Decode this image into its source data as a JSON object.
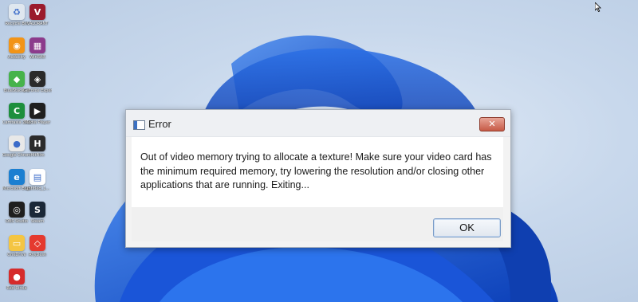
{
  "desktop": {
    "icons": [
      {
        "name": "recycle-bin-icon",
        "label": "Recycle Bin",
        "color": "#dfe7ef",
        "glyph": "♻"
      },
      {
        "name": "valorant-icon",
        "label": "VALORANT",
        "color": "#9b1b2c",
        "glyph": "V"
      },
      {
        "name": "audacity-icon",
        "label": "Audacity",
        "color": "#f29417",
        "glyph": "◉"
      },
      {
        "name": "winrar-icon",
        "label": "WinRAR",
        "color": "#8c3b8c",
        "glyph": "▦"
      },
      {
        "name": "bluestacks-icon",
        "label": "BlueStacks 5",
        "color": "#46b34b",
        "glyph": "◆"
      },
      {
        "name": "geforce-experience-icon",
        "label": "GeForce Experience",
        "color": "#2a2a2a",
        "glyph": "◈"
      },
      {
        "name": "camtasia-icon",
        "label": "Camtasia 2021",
        "color": "#1d8f3d",
        "glyph": "C"
      },
      {
        "name": "media-player-icon",
        "label": "Media Player",
        "color": "#1f1f1f",
        "glyph": "▶"
      },
      {
        "name": "google-chrome-icon",
        "label": "Google Chrome",
        "color": "#e8e8e8",
        "glyph": "●"
      },
      {
        "name": "hitfilm-icon",
        "label": "HitFilm",
        "color": "#2b2b2b",
        "glyph": "H"
      },
      {
        "name": "microsoft-edge-icon",
        "label": "Microsoft Edge",
        "color": "#1b7fd1",
        "glyph": "e"
      },
      {
        "name": "document-file-icon",
        "label": "Untitled_1...",
        "color": "#ffffff",
        "glyph": "▤"
      },
      {
        "name": "obs-studio-icon",
        "label": "OBS Studio",
        "color": "#1f1f1f",
        "glyph": "◎"
      },
      {
        "name": "steam-icon",
        "label": "Steam",
        "color": "#1b2838",
        "glyph": "S"
      },
      {
        "name": "onedrive-icon",
        "label": "OneDrive",
        "color": "#f4c542",
        "glyph": "▭"
      },
      {
        "name": "anydesk-icon",
        "label": "AnyDesk",
        "color": "#e53a2f",
        "glyph": "◇"
      },
      {
        "name": "red-circle-app-icon",
        "label": "Red Circle",
        "color": "#d62b2b",
        "glyph": "●"
      }
    ]
  },
  "dialog": {
    "title": "Error",
    "close_glyph": "✕",
    "message": "Out of video memory trying to allocate a texture! Make sure your video card has the minimum required memory, try lowering the resolution and/or closing other applications that are running. Exiting...",
    "ok_label": "OK"
  }
}
